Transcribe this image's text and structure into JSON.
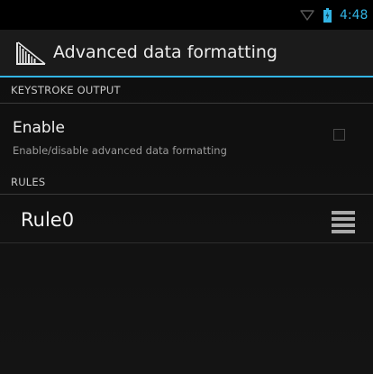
{
  "status_bar": {
    "time": "4:48",
    "wifi_icon": "wifi-icon",
    "battery_icon": "battery-icon",
    "accent_color": "#33b5e5"
  },
  "action_bar": {
    "title": "Advanced data formatting",
    "app_icon": "barcode-scanner-icon"
  },
  "sections": [
    {
      "header": "KEYSTROKE OUTPUT"
    },
    {
      "header": "RULES"
    }
  ],
  "enable_pref": {
    "title": "Enable",
    "summary": "Enable/disable advanced data formatting",
    "checked": false
  },
  "rules": [
    {
      "label": "Rule0",
      "handle_icon": "drag-handle-icon"
    }
  ]
}
